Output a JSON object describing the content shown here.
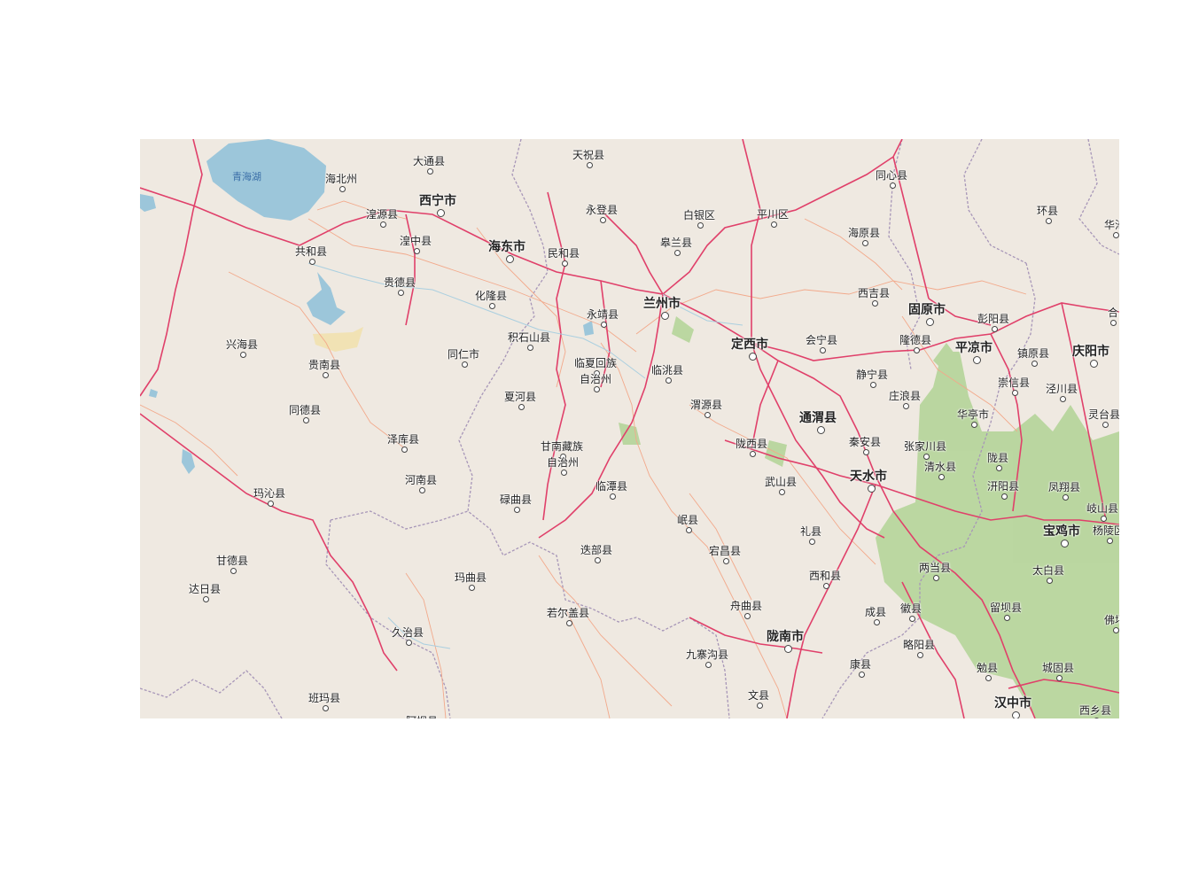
{
  "map": {
    "lake_label": "青海湖",
    "colors": {
      "land": "#efe9e1",
      "water": "#99c4d8",
      "forest": "#a9d08e",
      "major_road": "#e0406a",
      "minor_road": "#f0a080",
      "boundary": "#a796b8"
    },
    "places": [
      {
        "name": "大通县",
        "kind": "county"
      },
      {
        "name": "海北州",
        "kind": "county"
      },
      {
        "name": "西宁市",
        "kind": "city"
      },
      {
        "name": "湟源县",
        "kind": "county"
      },
      {
        "name": "湟中县",
        "kind": "county"
      },
      {
        "name": "共和县",
        "kind": "county"
      },
      {
        "name": "海东市",
        "kind": "city"
      },
      {
        "name": "民和县",
        "kind": "county"
      },
      {
        "name": "贵德县",
        "kind": "county"
      },
      {
        "name": "化隆县",
        "kind": "county"
      },
      {
        "name": "天祝县",
        "kind": "county"
      },
      {
        "name": "永登县",
        "kind": "county"
      },
      {
        "name": "白银区",
        "kind": "county"
      },
      {
        "name": "平川区",
        "kind": "county"
      },
      {
        "name": "皋兰县",
        "kind": "county"
      },
      {
        "name": "同心县",
        "kind": "county"
      },
      {
        "name": "海原县",
        "kind": "county"
      },
      {
        "name": "环县",
        "kind": "county"
      },
      {
        "name": "华池",
        "kind": "county"
      },
      {
        "name": "兰州市",
        "kind": "city"
      },
      {
        "name": "永靖县",
        "kind": "county"
      },
      {
        "name": "西吉县",
        "kind": "county"
      },
      {
        "name": "固原市",
        "kind": "city"
      },
      {
        "name": "彭阳县",
        "kind": "county"
      },
      {
        "name": "合",
        "kind": "county"
      },
      {
        "name": "兴海县",
        "kind": "county"
      },
      {
        "name": "贵南县",
        "kind": "county"
      },
      {
        "name": "积石山县",
        "kind": "county"
      },
      {
        "name": "同仁市",
        "kind": "county"
      },
      {
        "name": "临夏回族",
        "kind": "county"
      },
      {
        "name": "自治州",
        "kind": "county"
      },
      {
        "name": "临洮县",
        "kind": "county"
      },
      {
        "name": "定西市",
        "kind": "city"
      },
      {
        "name": "会宁县",
        "kind": "county"
      },
      {
        "name": "隆德县",
        "kind": "county"
      },
      {
        "name": "平凉市",
        "kind": "city"
      },
      {
        "name": "镇原县",
        "kind": "county"
      },
      {
        "name": "庆阳市",
        "kind": "city"
      },
      {
        "name": "静宁县",
        "kind": "county"
      },
      {
        "name": "崇信县",
        "kind": "county"
      },
      {
        "name": "泾川县",
        "kind": "county"
      },
      {
        "name": "同德县",
        "kind": "county"
      },
      {
        "name": "夏河县",
        "kind": "county"
      },
      {
        "name": "渭源县",
        "kind": "county"
      },
      {
        "name": "通渭县",
        "kind": "city"
      },
      {
        "name": "庄浪县",
        "kind": "county"
      },
      {
        "name": "华亭市",
        "kind": "county"
      },
      {
        "name": "灵台县",
        "kind": "county"
      },
      {
        "name": "泽库县",
        "kind": "county"
      },
      {
        "name": "甘南藏族",
        "kind": "county"
      },
      {
        "name": "自治州",
        "kind": "county"
      },
      {
        "name": "陇西县",
        "kind": "county"
      },
      {
        "name": "秦安县",
        "kind": "county"
      },
      {
        "name": "张家川县",
        "kind": "county"
      },
      {
        "name": "陇县",
        "kind": "county"
      },
      {
        "name": "清水县",
        "kind": "county"
      },
      {
        "name": "河南县",
        "kind": "county"
      },
      {
        "name": "临潭县",
        "kind": "county"
      },
      {
        "name": "武山县",
        "kind": "county"
      },
      {
        "name": "天水市",
        "kind": "city"
      },
      {
        "name": "汧阳县",
        "kind": "county"
      },
      {
        "name": "凤翔县",
        "kind": "county"
      },
      {
        "name": "玛沁县",
        "kind": "county"
      },
      {
        "name": "碌曲县",
        "kind": "county"
      },
      {
        "name": "岐山县",
        "kind": "county"
      },
      {
        "name": "岷县",
        "kind": "county"
      },
      {
        "name": "宝鸡市",
        "kind": "city"
      },
      {
        "name": "杨陵区",
        "kind": "county"
      },
      {
        "name": "礼县",
        "kind": "county"
      },
      {
        "name": "迭部县",
        "kind": "county"
      },
      {
        "name": "宕昌县",
        "kind": "county"
      },
      {
        "name": "甘德县",
        "kind": "county"
      },
      {
        "name": "两当县",
        "kind": "county"
      },
      {
        "name": "太白县",
        "kind": "county"
      },
      {
        "name": "玛曲县",
        "kind": "county"
      },
      {
        "name": "西和县",
        "kind": "county"
      },
      {
        "name": "达日县",
        "kind": "county"
      },
      {
        "name": "舟曲县",
        "kind": "county"
      },
      {
        "name": "若尔盖县",
        "kind": "county"
      },
      {
        "name": "成县",
        "kind": "county"
      },
      {
        "name": "徽县",
        "kind": "county"
      },
      {
        "name": "留坝县",
        "kind": "county"
      },
      {
        "name": "佛坪",
        "kind": "county"
      },
      {
        "name": "久治县",
        "kind": "county"
      },
      {
        "name": "陇南市",
        "kind": "city"
      },
      {
        "name": "略阳县",
        "kind": "county"
      },
      {
        "name": "九寨沟县",
        "kind": "county"
      },
      {
        "name": "康县",
        "kind": "county"
      },
      {
        "name": "勉县",
        "kind": "county"
      },
      {
        "name": "城固县",
        "kind": "county"
      },
      {
        "name": "班玛县",
        "kind": "county"
      },
      {
        "name": "文县",
        "kind": "county"
      },
      {
        "name": "汉中市",
        "kind": "city"
      },
      {
        "name": "西乡县",
        "kind": "county"
      },
      {
        "name": "阿坝县",
        "kind": "county"
      }
    ]
  }
}
